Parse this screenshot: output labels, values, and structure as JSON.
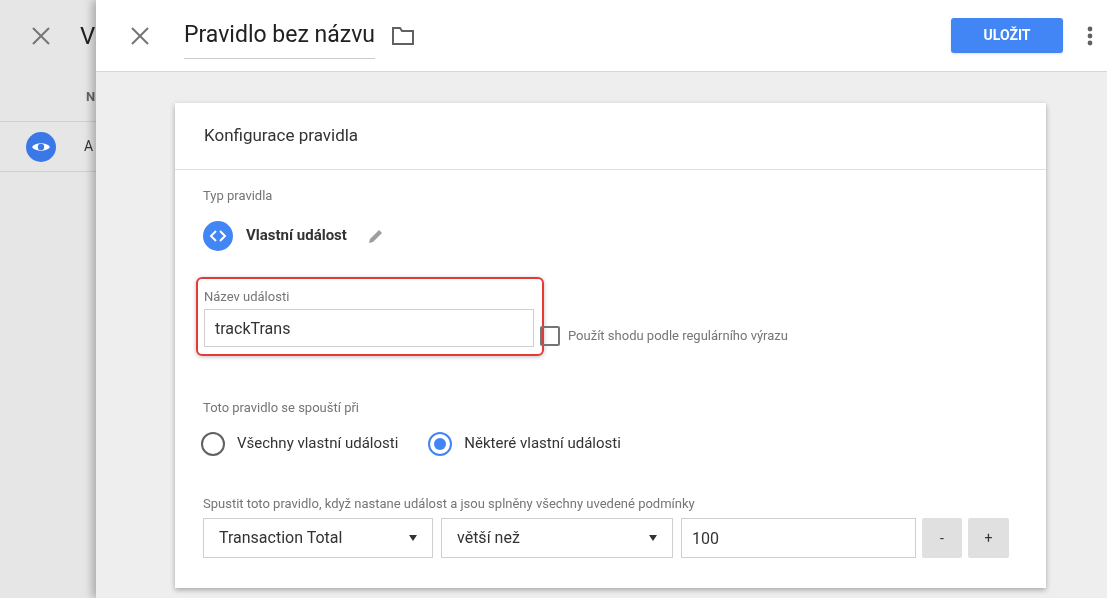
{
  "back_panel": {
    "title": "V",
    "column_header": "N",
    "row_text": "A"
  },
  "header": {
    "title": "Pravidlo bez názvu",
    "save_button": "ULOŽIT"
  },
  "card": {
    "title": "Konfigurace pravidla",
    "type_label": "Typ pravidla",
    "type_value": "Vlastní událost",
    "event_name": {
      "label": "Název události",
      "value": "trackTrans",
      "highlighted": true
    },
    "regex": {
      "label": "Použít shodu podle regulárního výrazu",
      "checked": false
    },
    "fires_on": {
      "label": "Toto pravidlo se spouští při",
      "options": [
        {
          "label": "Všechny vlastní události",
          "selected": false
        },
        {
          "label": "Některé vlastní události",
          "selected": true
        }
      ]
    },
    "condition": {
      "label": "Spustit toto pravidlo, když nastane událost a jsou splněny všechny uvedené podmínky",
      "variable": "Transaction Total",
      "operator": "větší než",
      "value": "100",
      "remove_button": "-",
      "add_button": "+"
    }
  }
}
